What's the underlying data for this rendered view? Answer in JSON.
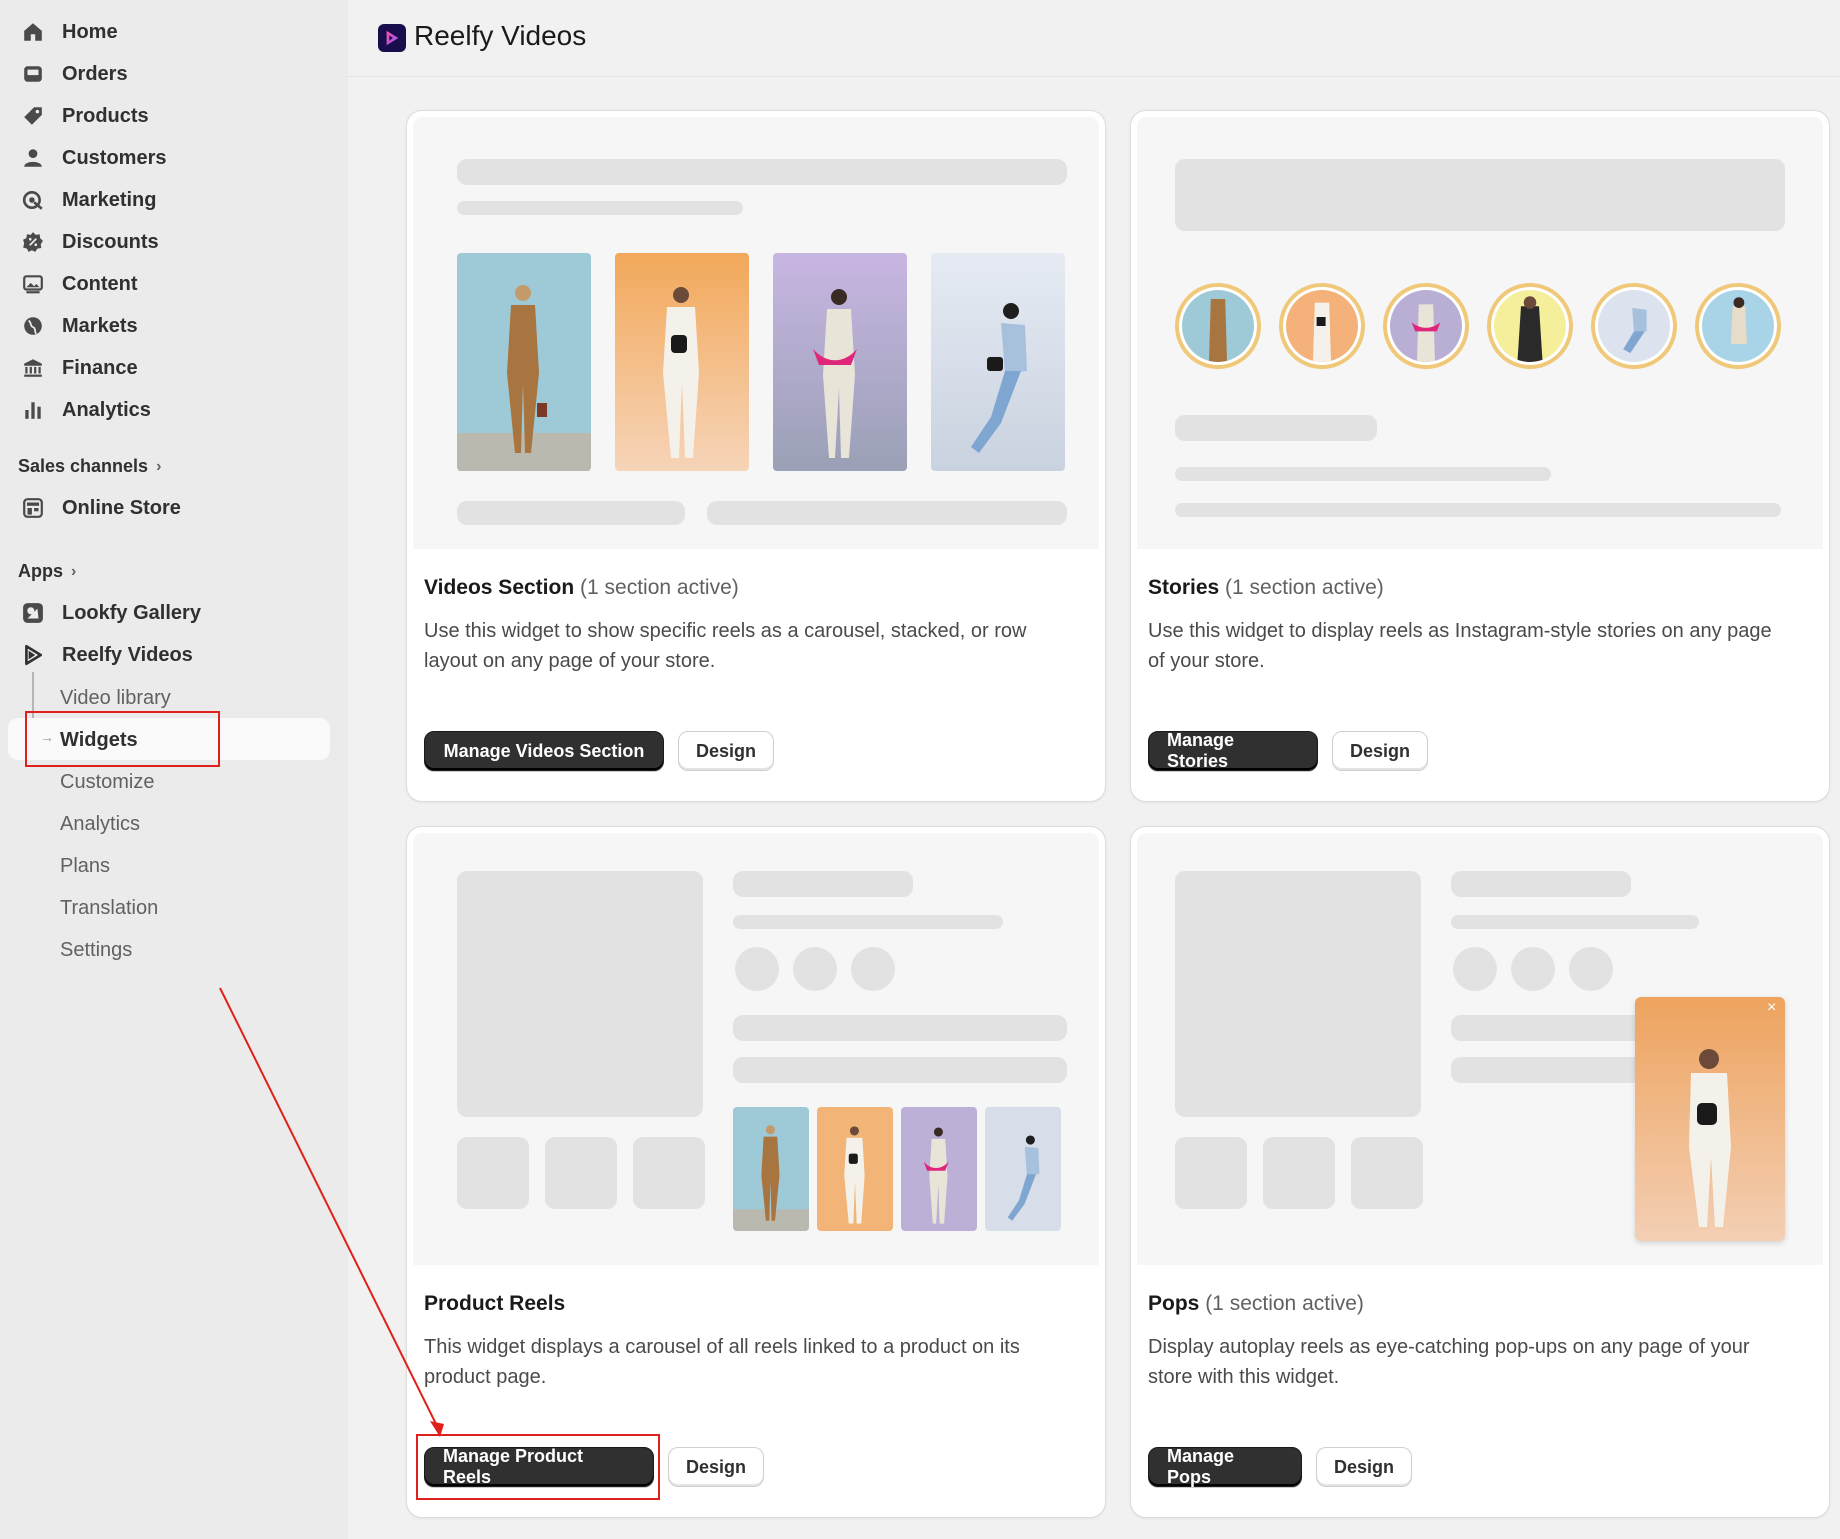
{
  "sidebar": {
    "nav": [
      {
        "label": "Home",
        "icon": "home-icon"
      },
      {
        "label": "Orders",
        "icon": "orders-icon"
      },
      {
        "label": "Products",
        "icon": "tag-icon"
      },
      {
        "label": "Customers",
        "icon": "person-icon"
      },
      {
        "label": "Marketing",
        "icon": "target-icon"
      },
      {
        "label": "Discounts",
        "icon": "discount-icon"
      },
      {
        "label": "Content",
        "icon": "image-icon"
      },
      {
        "label": "Markets",
        "icon": "globe-icon"
      },
      {
        "label": "Finance",
        "icon": "bank-icon"
      },
      {
        "label": "Analytics",
        "icon": "bar-chart-icon"
      }
    ],
    "sales_channels_label": "Sales channels",
    "online_store_label": "Online Store",
    "apps_label": "Apps",
    "apps": [
      {
        "label": "Lookfy Gallery",
        "icon": "lookfy-icon"
      },
      {
        "label": "Reelfy Videos",
        "icon": "reelfy-icon"
      }
    ],
    "reelfy_sub": [
      "Video library",
      "Widgets",
      "Customize",
      "Analytics",
      "Plans",
      "Translation",
      "Settings"
    ],
    "active_sub": "Widgets"
  },
  "header": {
    "title": "Reelfy Videos"
  },
  "cards": [
    {
      "title": "Videos Section",
      "subtitle": "(1 section active)",
      "description": "Use this widget to show specific reels as a carousel, stacked, or row layout on any page of your store.",
      "primary_button": "Manage Videos Section",
      "secondary_button": "Design"
    },
    {
      "title": "Stories",
      "subtitle": "(1 section active)",
      "description": "Use this widget to display reels as Instagram-style stories on any page of your store.",
      "primary_button": "Manage Stories",
      "secondary_button": "Design"
    },
    {
      "title": "Product Reels",
      "subtitle": "",
      "description": "This widget displays a carousel of all reels linked to a product on its product page.",
      "primary_button": "Manage Product Reels",
      "secondary_button": "Design"
    },
    {
      "title": "Pops",
      "subtitle": "(1 section active)",
      "description": "Display autoplay reels as eye-catching pop-ups on any page of your store with this widget.",
      "primary_button": "Manage Pops",
      "secondary_button": "Design"
    }
  ],
  "pop_close_glyph": "×",
  "colors": {
    "highlight": "#e0201b",
    "dark_button": "#303030",
    "story_ring": "#f0c87a"
  }
}
